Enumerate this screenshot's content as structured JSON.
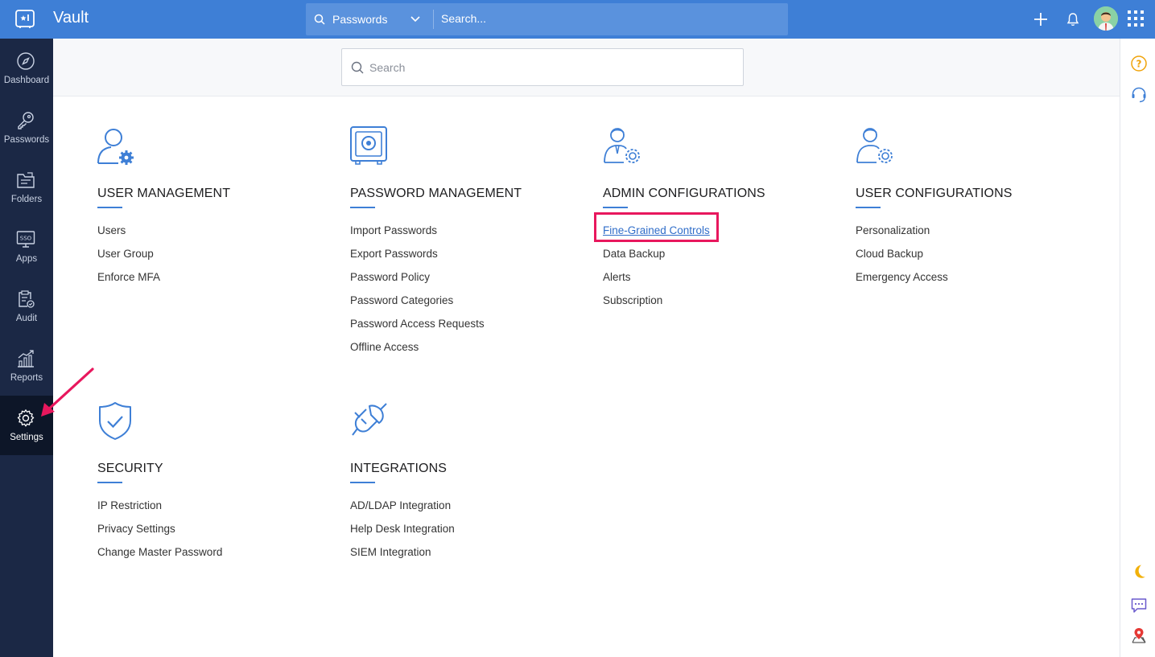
{
  "header": {
    "app_title": "Vault",
    "search_scope": "Passwords",
    "search_placeholder": "Search..."
  },
  "sidebar": {
    "items": [
      {
        "label": "Dashboard",
        "icon": "compass-icon"
      },
      {
        "label": "Passwords",
        "icon": "key-icon"
      },
      {
        "label": "Folders",
        "icon": "folder-icon"
      },
      {
        "label": "Apps",
        "icon": "sso-icon"
      },
      {
        "label": "Audit",
        "icon": "audit-icon"
      },
      {
        "label": "Reports",
        "icon": "chart-icon"
      },
      {
        "label": "Settings",
        "icon": "gear-icon",
        "active": true
      }
    ]
  },
  "main": {
    "search_placeholder": "Search",
    "sections": [
      {
        "title": "USER MANAGEMENT",
        "icon": "user-gear-icon",
        "items": [
          "Users",
          "User Group",
          "Enforce MFA"
        ]
      },
      {
        "title": "PASSWORD MANAGEMENT",
        "icon": "safe-icon",
        "items": [
          "Import Passwords",
          "Export Passwords",
          "Password Policy",
          "Password Categories",
          "Password Access Requests",
          "Offline Access"
        ]
      },
      {
        "title": "ADMIN CONFIGURATIONS",
        "icon": "admin-gear-icon",
        "items": [
          "Fine-Grained Controls",
          "Data Backup",
          "Alerts",
          "Subscription"
        ]
      },
      {
        "title": "USER CONFIGURATIONS",
        "icon": "user-config-icon",
        "items": [
          "Personalization",
          "Cloud Backup",
          "Emergency Access"
        ]
      },
      {
        "title": "SECURITY",
        "icon": "shield-check-icon",
        "items": [
          "IP Restriction",
          "Privacy Settings",
          "Change Master Password"
        ]
      },
      {
        "title": "INTEGRATIONS",
        "icon": "plug-icon",
        "items": [
          "AD/LDAP Integration",
          "Help Desk Integration",
          "SIEM Integration"
        ]
      }
    ]
  },
  "colors": {
    "topbar": "#3e7fd6",
    "sidebar": "#1b2845",
    "accent": "#3e7fd6",
    "highlight": "#e8175d",
    "link": "#2f6dc9"
  }
}
